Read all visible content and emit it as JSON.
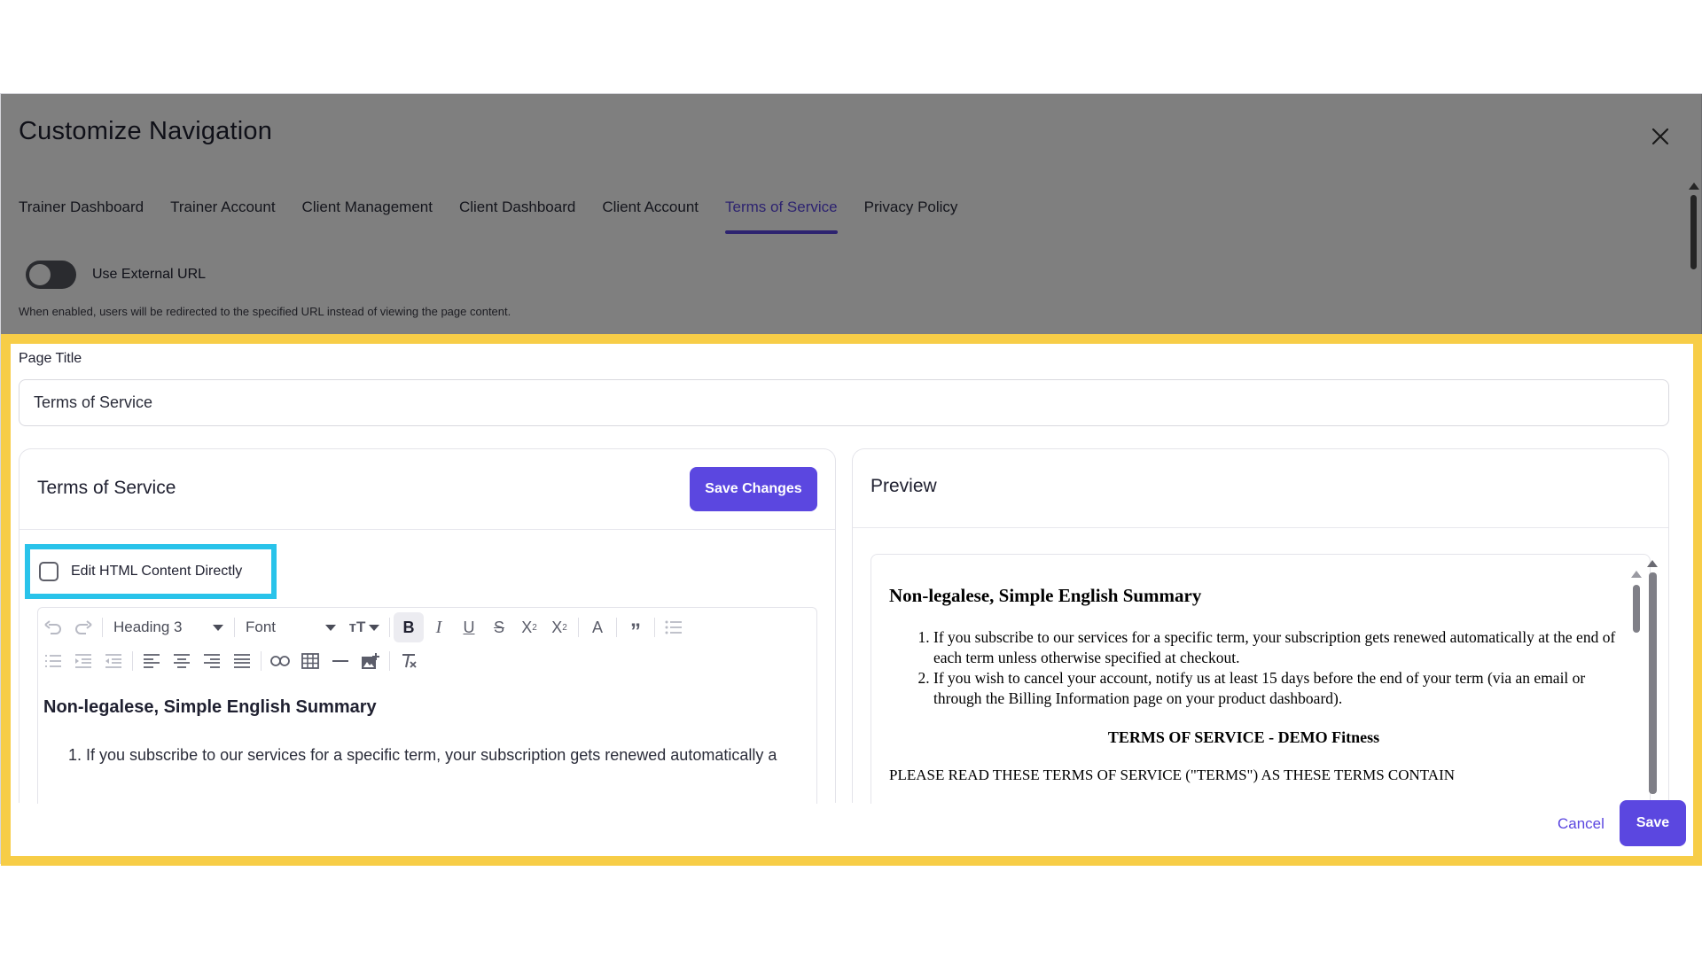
{
  "modal": {
    "title": "Customize Navigation",
    "tabs": [
      {
        "label": "Trainer Dashboard"
      },
      {
        "label": "Trainer Account"
      },
      {
        "label": "Client Management"
      },
      {
        "label": "Client Dashboard"
      },
      {
        "label": "Client Account"
      },
      {
        "label": "Terms of Service",
        "active": true
      },
      {
        "label": "Privacy Policy"
      }
    ],
    "external_url": {
      "label": "Use External URL",
      "enabled": false,
      "helper": "When enabled, users will be redirected to the specified URL instead of viewing the page content."
    }
  },
  "page_title": {
    "label": "Page Title",
    "value": "Terms of Service"
  },
  "editor": {
    "title": "Terms of Service",
    "save_changes_label": "Save Changes",
    "edit_html_label": "Edit HTML Content Directly",
    "edit_html_checked": false,
    "toolbar": {
      "heading_select": "Heading 3",
      "font_select": "Font"
    },
    "content": {
      "heading": "Non-legalese, Simple English Summary",
      "item_1": "1. If you subscribe to our services for a specific term, your subscription gets renewed automatically a"
    }
  },
  "preview": {
    "title": "Preview",
    "heading": "Non-legalese, Simple English Summary",
    "items": [
      "If you subscribe to our services for a specific term, your subscription gets renewed automatically at the end of each term unless otherwise specified at checkout.",
      "If you wish to cancel your account, notify us at least 15 days before the end of your term (via an email or through the Billing Information page on your product dashboard)."
    ],
    "terms_heading": "TERMS OF SERVICE - DEMO Fitness",
    "please_read": "PLEASE READ THESE TERMS OF SERVICE (\"TERMS\") AS THESE TERMS CONTAIN"
  },
  "footer": {
    "cancel_label": "Cancel",
    "save_label": "Save"
  },
  "colors": {
    "accent": "#5b47e0",
    "highlight_yellow": "#f7cd47",
    "highlight_cyan": "#29c3ea"
  },
  "icons": [
    "close-icon",
    "undo-icon",
    "redo-icon",
    "text-size-icon",
    "bold-icon",
    "italic-icon",
    "underline-icon",
    "strikethrough-icon",
    "subscript-icon",
    "superscript-icon",
    "font-color-icon",
    "blockquote-icon",
    "bullet-list-icon",
    "numbered-list-icon",
    "indent-icon",
    "outdent-icon",
    "align-left-icon",
    "align-center-icon",
    "align-right-icon",
    "align-justify-icon",
    "link-icon",
    "table-icon",
    "horizontal-rule-icon",
    "image-icon",
    "clear-format-icon"
  ]
}
